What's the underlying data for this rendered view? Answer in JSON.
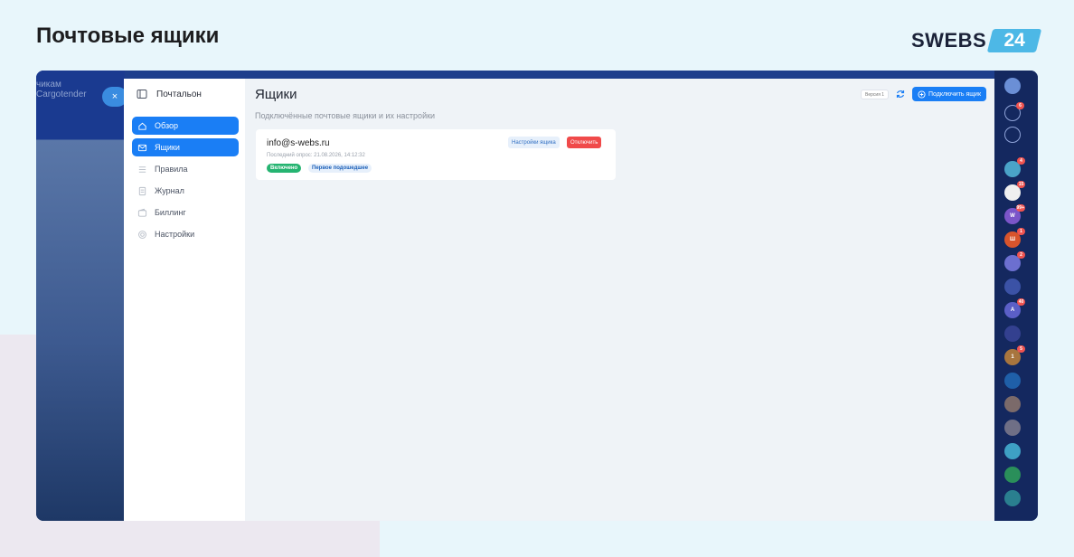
{
  "page": {
    "heading": "Почтовые ящики",
    "brand": {
      "name": "SWEBS",
      "number": "24",
      "color": "#4db8e6"
    }
  },
  "background_app": {
    "tabs": [
      "чикам",
      "Cargotender"
    ],
    "close_label": "×"
  },
  "sidebar": {
    "title": "Почтальон",
    "items": [
      {
        "label": "Обзор",
        "icon": "home-icon",
        "active": true
      },
      {
        "label": "Ящики",
        "icon": "mail-icon",
        "active": true
      },
      {
        "label": "Правила",
        "icon": "list-icon",
        "active": false
      },
      {
        "label": "Журнал",
        "icon": "journal-icon",
        "active": false
      },
      {
        "label": "Биллинг",
        "icon": "wallet-icon",
        "active": false
      },
      {
        "label": "Настройки",
        "icon": "gear-icon",
        "active": false
      }
    ]
  },
  "main": {
    "title": "Ящики",
    "subtitle": "Подключённые почтовые ящики и их настройки",
    "version_label": "Версия 1",
    "connect_label": "Подключить ящик"
  },
  "mailbox": {
    "email": "info@s-webs.ru",
    "last_poll": "Последний опрос: 21.08.2026, 14:12:32",
    "status_badge": "Включено",
    "mode_badge": "Первое подошедшее",
    "settings_label": "Настройки ящика",
    "disconnect_label": "Отключить"
  },
  "rail": {
    "items": [
      {
        "text": "",
        "badge": "",
        "color": "#6b8fd6"
      },
      {
        "text": "",
        "badge": "6",
        "color": "#2a3f7a"
      },
      {
        "text": "",
        "badge": "",
        "color": "#2a3f7a"
      },
      {
        "text": "",
        "badge": "4",
        "color": "#4aa3c8"
      },
      {
        "text": "",
        "badge": "15",
        "color": "#f0f0f0"
      },
      {
        "text": "W",
        "badge": "99+",
        "color": "#7b55c9"
      },
      {
        "text": "Ш",
        "badge": "1",
        "color": "#d8542c"
      },
      {
        "text": "",
        "badge": "2",
        "color": "#6c6fd0"
      },
      {
        "text": "",
        "badge": "",
        "color": "#3b52a6"
      },
      {
        "text": "A",
        "badge": "40",
        "color": "#5b5fc7"
      },
      {
        "text": "",
        "badge": "",
        "color": "#33408f"
      },
      {
        "text": "1",
        "badge": "5",
        "color": "#a8753e"
      },
      {
        "text": "",
        "badge": "",
        "color": "#1f5fa8"
      },
      {
        "text": "",
        "badge": "",
        "color": "#7b6a6a"
      },
      {
        "text": "",
        "badge": "",
        "color": "#6f6f86"
      },
      {
        "text": "",
        "badge": "",
        "color": "#3ea0c4"
      },
      {
        "text": "",
        "badge": "",
        "color": "#2a8f5a"
      },
      {
        "text": "",
        "badge": "",
        "color": "#2a7f8f"
      }
    ]
  }
}
